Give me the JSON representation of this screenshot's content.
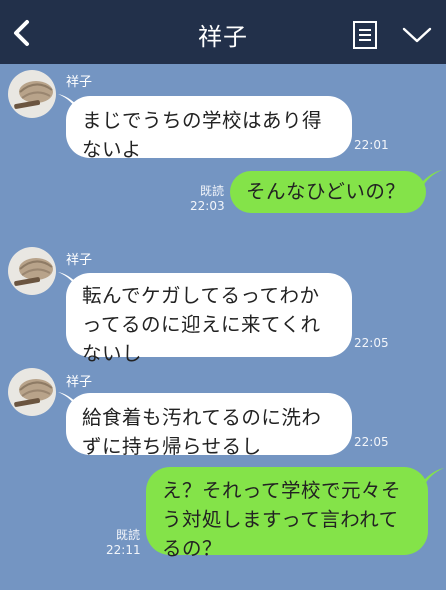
{
  "header": {
    "title": "祥子",
    "back_icon": "back-chevron-icon",
    "menu_icon": "note-list-icon",
    "expand_icon": "chevron-down-icon"
  },
  "messages": [
    {
      "side": "in",
      "sender": "祥子",
      "text": "まじでうちの学校はあり得ないよ",
      "time": "22:01"
    },
    {
      "side": "out",
      "read": "既読",
      "text": "そんなひどいの？",
      "time": "22:03"
    },
    {
      "side": "in",
      "sender": "祥子",
      "text": "転んでケガしてるってわかってるのに迎えに来てくれないし",
      "time": "22:05"
    },
    {
      "side": "in",
      "sender": "祥子",
      "text": "給食着も汚れてるのに洗わずに持ち帰らせるし",
      "time": "22:05"
    },
    {
      "side": "out",
      "read": "既読",
      "text": "え？それって学校で元々そう対処しますって言われてるの？",
      "time": "22:11"
    }
  ],
  "colors": {
    "header_bg": "#22304a",
    "chat_bg": "#7495c2",
    "incoming_bubble": "#ffffff",
    "outgoing_bubble": "#84e349"
  }
}
